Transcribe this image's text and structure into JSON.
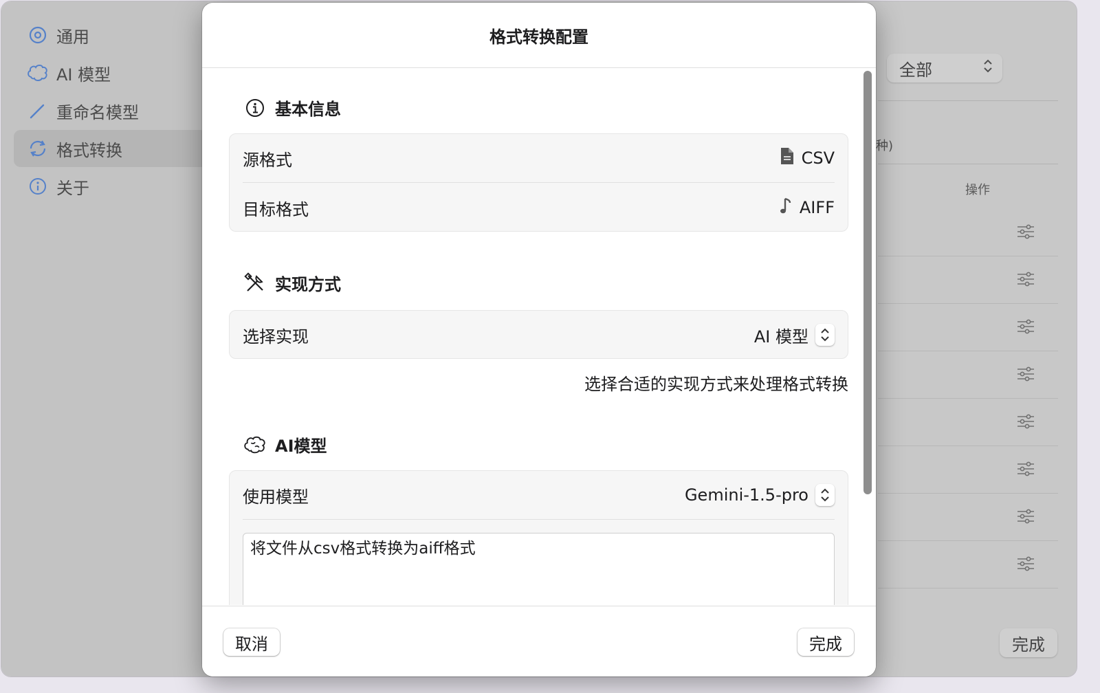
{
  "sidebar": {
    "items": [
      {
        "label": "通用",
        "icon": "gear-icon"
      },
      {
        "label": "AI 模型",
        "icon": "brain-icon"
      },
      {
        "label": "重命名模型",
        "icon": "pencil-icon"
      },
      {
        "label": "格式转换",
        "icon": "sync-icon",
        "active": true
      },
      {
        "label": "关于",
        "icon": "info-icon"
      }
    ]
  },
  "background": {
    "filter_value": "全部",
    "count_fragment": "种)",
    "ops_header": "操作",
    "done_label": "完成"
  },
  "dialog": {
    "title": "格式转换配置",
    "basic": {
      "heading": "基本信息",
      "source_label": "源格式",
      "source_value": "CSV",
      "target_label": "目标格式",
      "target_value": "AIFF"
    },
    "impl": {
      "heading": "实现方式",
      "select_label": "选择实现",
      "select_value": "AI 模型",
      "hint": "选择合适的实现方式来处理格式转换"
    },
    "ai": {
      "heading": "AI模型",
      "model_label": "使用模型",
      "model_value": "Gemini-1.5-pro",
      "prompt_text": "将文件从csv格式转换为aiff格式"
    },
    "cancel_label": "取消",
    "done_label": "完成"
  },
  "colors": {
    "accent": "#3b82f6",
    "sheet_bg": "#ffffff",
    "card_bg": "#f6f6f6"
  }
}
